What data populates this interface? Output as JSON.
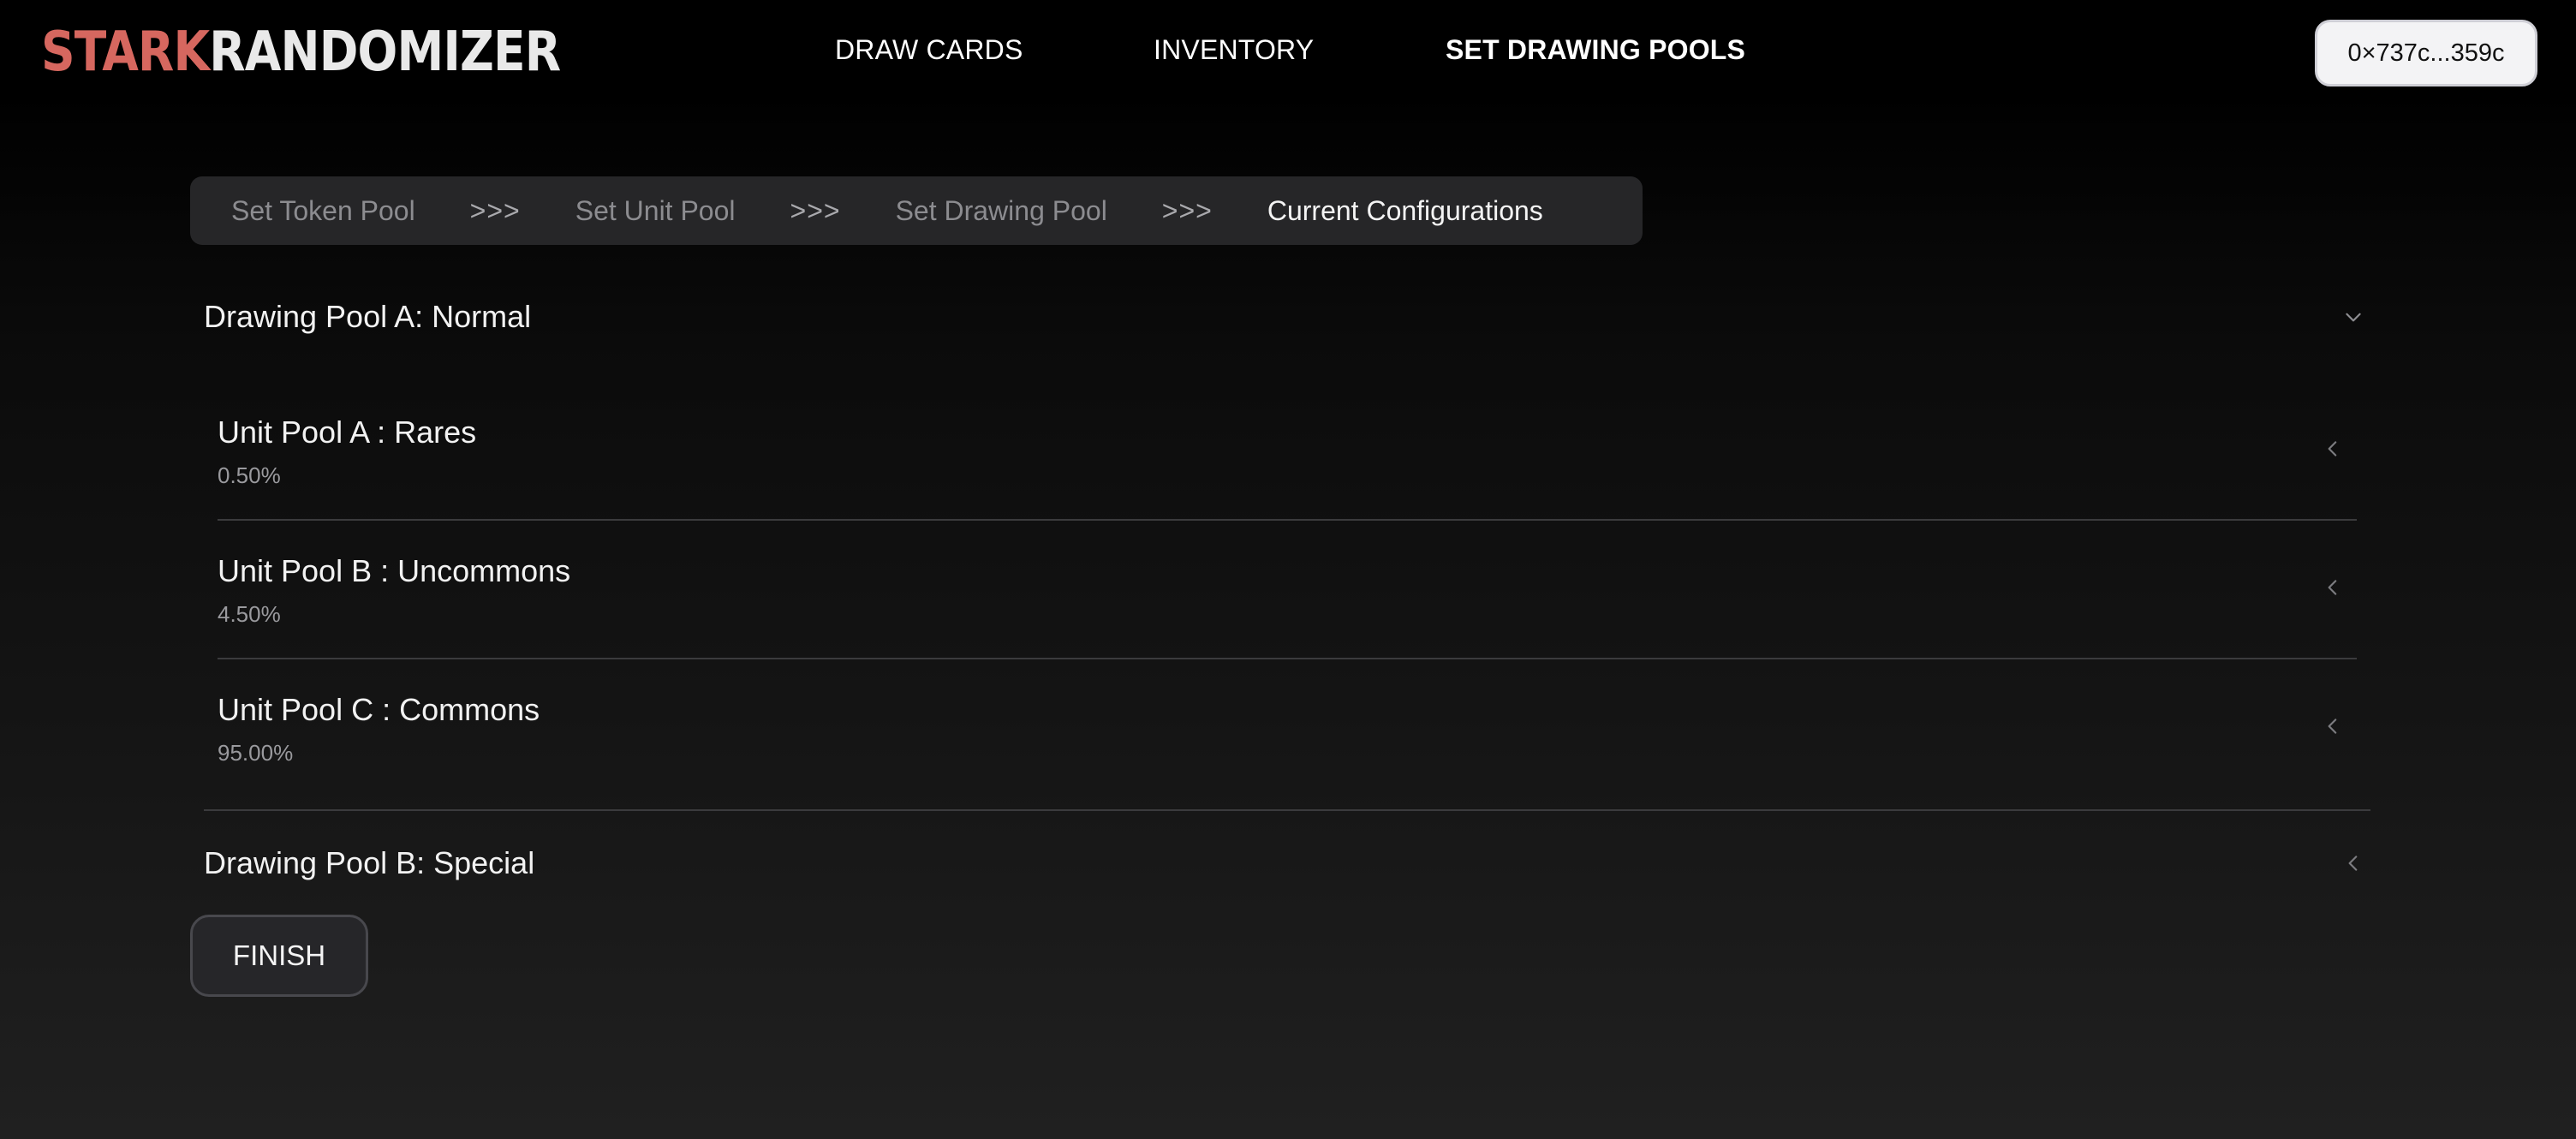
{
  "app": {
    "logo": {
      "part1": "STARK",
      "part2": "RANDOMIZER"
    },
    "colors": {
      "logo_accent": "#d6675f",
      "logo_light": "#e9e9e9"
    }
  },
  "nav": {
    "links": [
      {
        "label": "DRAW CARDS",
        "active": false
      },
      {
        "label": "INVENTORY",
        "active": false
      },
      {
        "label": "SET DRAWING POOLS",
        "active": true
      }
    ],
    "wallet": {
      "address": "0×737c...359c"
    }
  },
  "stepper": {
    "separator": ">>>",
    "steps": [
      {
        "label": "Set Token Pool",
        "current": false
      },
      {
        "label": "Set Unit Pool",
        "current": false
      },
      {
        "label": "Set Drawing Pool",
        "current": false
      },
      {
        "label": "Current Configurations",
        "current": true
      }
    ]
  },
  "drawing_pools": [
    {
      "title": "Drawing Pool A: Normal",
      "expanded": true,
      "icon": "chevron-down-icon",
      "unit_pools": [
        {
          "name": "Unit Pool A : Rares",
          "probability": "0.50%",
          "icon": "chevron-left-icon"
        },
        {
          "name": "Unit Pool B : Uncommons",
          "probability": "4.50%",
          "icon": "chevron-left-icon"
        },
        {
          "name": "Unit Pool C : Commons",
          "probability": "95.00%",
          "icon": "chevron-left-icon"
        }
      ]
    },
    {
      "title": "Drawing Pool B: Special",
      "expanded": false,
      "icon": "chevron-left-icon",
      "unit_pools": []
    }
  ],
  "actions": {
    "finish_label": "FINISH"
  }
}
